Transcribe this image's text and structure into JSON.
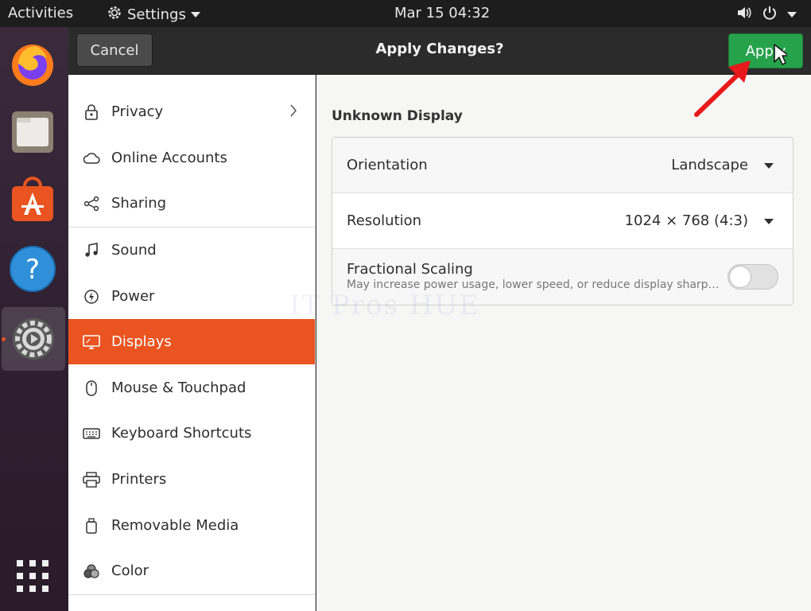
{
  "topbar": {
    "activities": "Activities",
    "app_menu": "Settings",
    "clock": "Mar 15  04:32"
  },
  "dock": {
    "items": [
      "firefox-icon",
      "files-icon",
      "software-store-icon",
      "help-icon",
      "settings-icon",
      "show-apps-icon"
    ]
  },
  "header": {
    "cancel_label": "Cancel",
    "title": "Apply Changes?",
    "apply_label": "Apply"
  },
  "sidebar": {
    "items": [
      {
        "label": "Privacy",
        "icon": "lock-icon"
      },
      {
        "label": "Online Accounts",
        "icon": "cloud-icon"
      },
      {
        "label": "Sharing",
        "icon": "share-icon"
      },
      {
        "label": "Sound",
        "icon": "music-note-icon"
      },
      {
        "label": "Power",
        "icon": "power-icon"
      },
      {
        "label": "Displays",
        "icon": "display-icon"
      },
      {
        "label": "Mouse & Touchpad",
        "icon": "mouse-icon"
      },
      {
        "label": "Keyboard Shortcuts",
        "icon": "keyboard-icon"
      },
      {
        "label": "Printers",
        "icon": "printer-icon"
      },
      {
        "label": "Removable Media",
        "icon": "usb-drive-icon"
      },
      {
        "label": "Color",
        "icon": "color-icon"
      }
    ],
    "selected": "Displays"
  },
  "main": {
    "section_title": "Unknown Display",
    "orientation_label": "Orientation",
    "orientation_value": "Landscape",
    "resolution_label": "Resolution",
    "resolution_value": "1024 × 768 (4:3)",
    "scaling_label": "Fractional Scaling",
    "scaling_sub": "May increase power usage, lower speed, or reduce display sharp…",
    "scaling_enabled": false
  },
  "watermark": "IT Pros HUE",
  "colors": {
    "accent": "#e95420",
    "apply_green": "#26a24b",
    "annotation_red": "#e8191a"
  }
}
